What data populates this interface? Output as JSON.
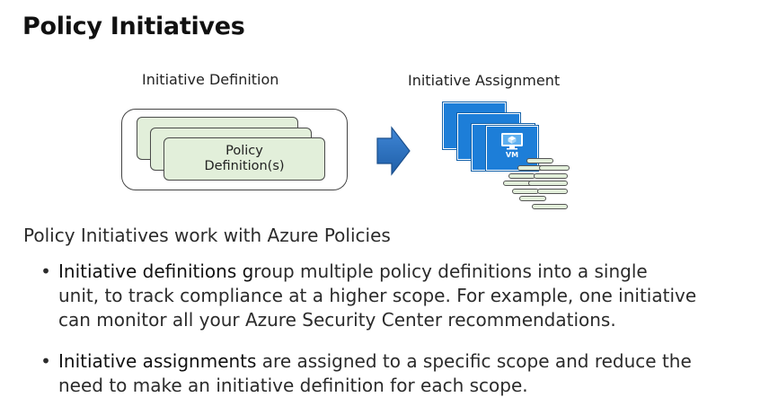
{
  "slide": {
    "title": "Policy Initiatives",
    "diagram": {
      "definition_label": "Initiative Definition",
      "assignment_label": "Initiative Assignment",
      "card_line_1": "Policy",
      "card_line_2": "Definition(s)",
      "vm_badge": "VM",
      "colors": {
        "card_fill": "#e2efda",
        "vm_blue": "#1d7ed8",
        "arrow_blue": "#2e75c7"
      }
    },
    "lead": "Policy Initiatives work with Azure Policies",
    "bullets": [
      {
        "term": "Initiative definitions g",
        "line_1_rest": "roup multiple policy definitions into a single",
        "line_2": "unit, to track compliance at a higher scope. For example, one initiative",
        "line_3": "can monitor all your Azure Security Center recommendations."
      },
      {
        "term": "Initiative assignments",
        "line_1_rest": " are assigned to a specific scope and reduce the",
        "line_2": "need to make an initiative definition for each scope."
      }
    ],
    "bullet_glyph": "•"
  }
}
